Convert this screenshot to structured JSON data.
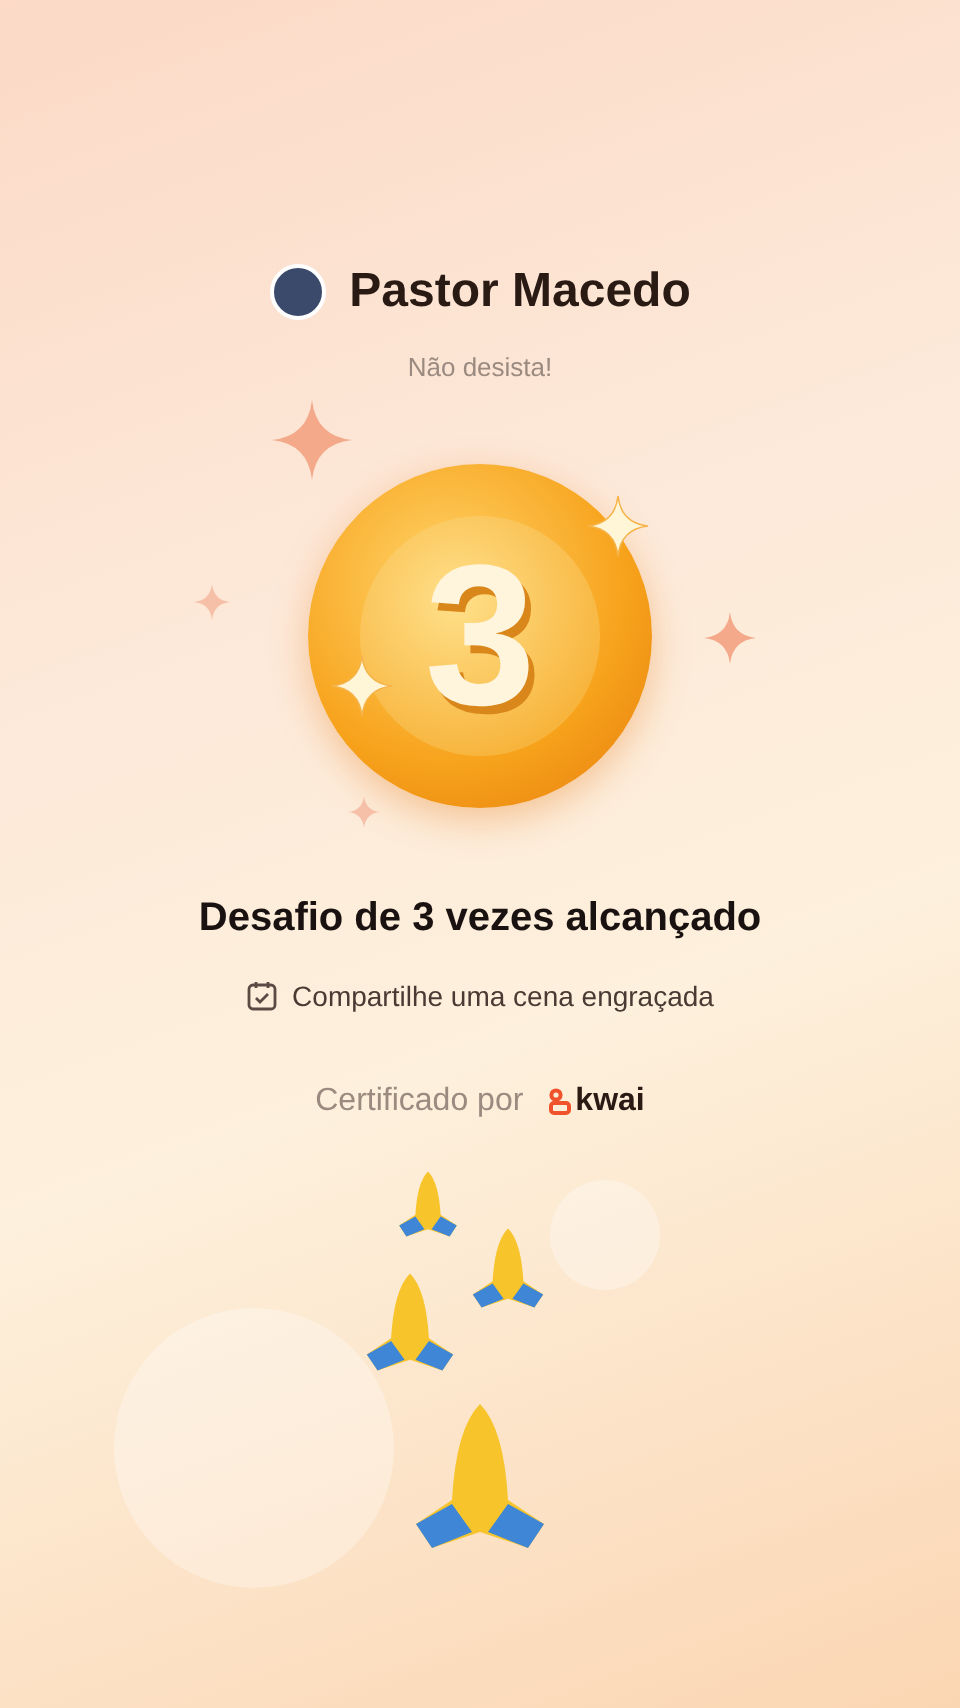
{
  "profile": {
    "name": "Pastor Macedo",
    "subtitle": "Não desista!"
  },
  "medal": {
    "number": "3"
  },
  "title": "Desafio de 3 vezes alcançado",
  "task": {
    "label": "Compartilhe uma cena engraçada"
  },
  "certificate": {
    "label": "Certificado por",
    "brand": "kwai"
  }
}
